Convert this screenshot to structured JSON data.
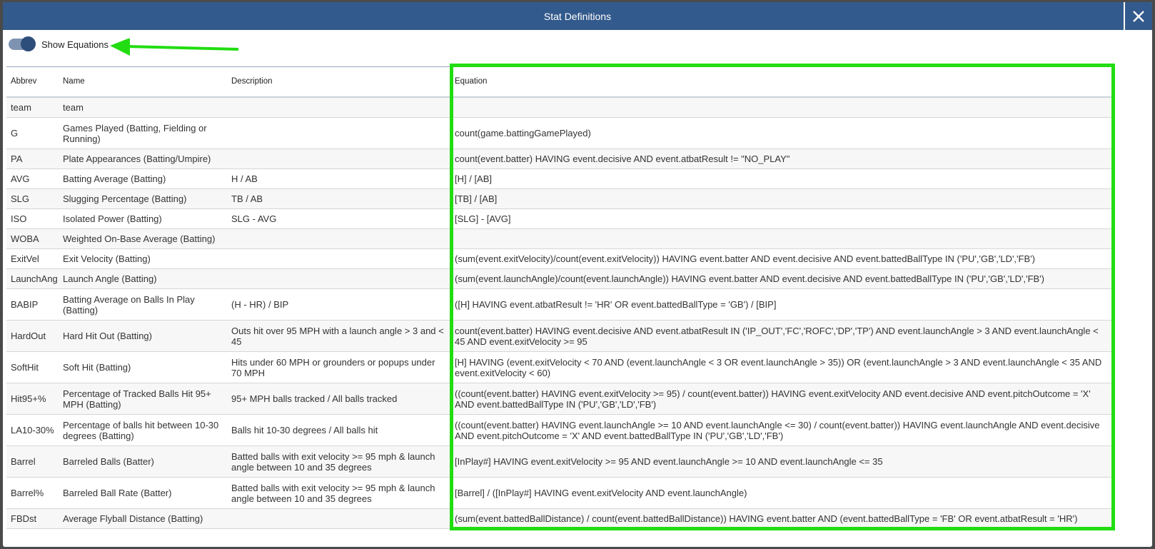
{
  "dialog": {
    "title": "Stat Definitions"
  },
  "toggle": {
    "label": "Show Equations",
    "checked": true
  },
  "annotation": {
    "color": "#22dd11"
  },
  "table": {
    "headers": [
      "Abbrev",
      "Name",
      "Description",
      "Equation"
    ],
    "rows": [
      [
        "team",
        "team",
        "",
        ""
      ],
      [
        "G",
        "Games Played (Batting, Fielding or Running)",
        "",
        "count(game.battingGamePlayed)"
      ],
      [
        "PA",
        "Plate Appearances (Batting/Umpire)",
        "",
        "count(event.batter) HAVING event.decisive AND event.atbatResult != \"NO_PLAY\""
      ],
      [
        "AVG",
        "Batting Average (Batting)",
        "H / AB",
        "[H] / [AB]"
      ],
      [
        "SLG",
        "Slugging Percentage (Batting)",
        "TB / AB",
        "[TB] / [AB]"
      ],
      [
        "ISO",
        "Isolated Power (Batting)",
        "SLG - AVG",
        "[SLG] - [AVG]"
      ],
      [
        "WOBA",
        "Weighted On-Base Average (Batting)",
        "",
        ""
      ],
      [
        "ExitVel",
        "Exit Velocity (Batting)",
        "",
        "(sum(event.exitVelocity)/count(event.exitVelocity)) HAVING event.batter AND event.decisive AND event.battedBallType IN ('PU','GB','LD','FB')"
      ],
      [
        "LaunchAng",
        "Launch Angle (Batting)",
        "",
        "(sum(event.launchAngle)/count(event.launchAngle)) HAVING event.batter AND event.decisive AND event.battedBallType IN ('PU','GB','LD','FB')"
      ],
      [
        "BABIP",
        "Batting Average on Balls In Play (Batting)",
        "(H - HR) / BIP",
        "([H] HAVING event.atbatResult != 'HR' OR event.battedBallType = 'GB') / [BIP]"
      ],
      [
        "HardOut",
        "Hard Hit Out (Batting)",
        "Outs hit over 95 MPH with a launch angle > 3 and < 45",
        "count(event.batter) HAVING event.decisive AND event.atbatResult IN ('IP_OUT','FC','ROFC','DP','TP') AND event.launchAngle > 3 AND event.launchAngle < 45 AND event.exitVelocity >= 95"
      ],
      [
        "SoftHit",
        "Soft Hit (Batting)",
        "Hits under 60 MPH or grounders or popups under 70 MPH",
        "[H] HAVING (event.exitVelocity < 70 AND (event.launchAngle < 3 OR event.launchAngle > 35)) OR (event.launchAngle > 3 AND event.launchAngle < 35 AND event.exitVelocity < 60)"
      ],
      [
        "Hit95+%",
        "Percentage of Tracked Balls Hit 95+ MPH (Batting)",
        "95+ MPH balls tracked / All balls tracked",
        "((count(event.batter) HAVING event.exitVelocity >= 95) / count(event.batter)) HAVING event.exitVelocity AND event.decisive AND event.pitchOutcome = 'X' AND event.battedBallType IN ('PU','GB','LD','FB')"
      ],
      [
        "LA10-30%",
        "Percentage of balls hit between 10-30 degrees (Batting)",
        "Balls hit 10-30 degrees / All balls hit",
        "((count(event.batter) HAVING event.launchAngle >= 10 AND event.launchAngle <= 30) / count(event.batter)) HAVING event.launchAngle AND event.decisive AND event.pitchOutcome = 'X' AND event.battedBallType IN ('PU','GB','LD','FB')"
      ],
      [
        "Barrel",
        "Barreled Balls (Batter)",
        "Batted balls with exit velocity >= 95 mph & launch angle between 10 and 35 degrees",
        "[InPlay#] HAVING event.exitVelocity >= 95 AND event.launchAngle >= 10 AND event.launchAngle <= 35"
      ],
      [
        "Barrel%",
        "Barreled Ball Rate (Batter)",
        "Batted balls with exit velocity >= 95 mph & launch angle between 10 and 35 degrees",
        "[Barrel] / ([InPlay#] HAVING event.exitVelocity AND event.launchAngle)"
      ],
      [
        "FBDst",
        "Average Flyball Distance (Batting)",
        "",
        "(sum(event.battedBallDistance) / count(event.battedBallDistance)) HAVING event.batter AND (event.battedBallType = 'FB' OR event.atbatResult = 'HR')"
      ]
    ]
  }
}
